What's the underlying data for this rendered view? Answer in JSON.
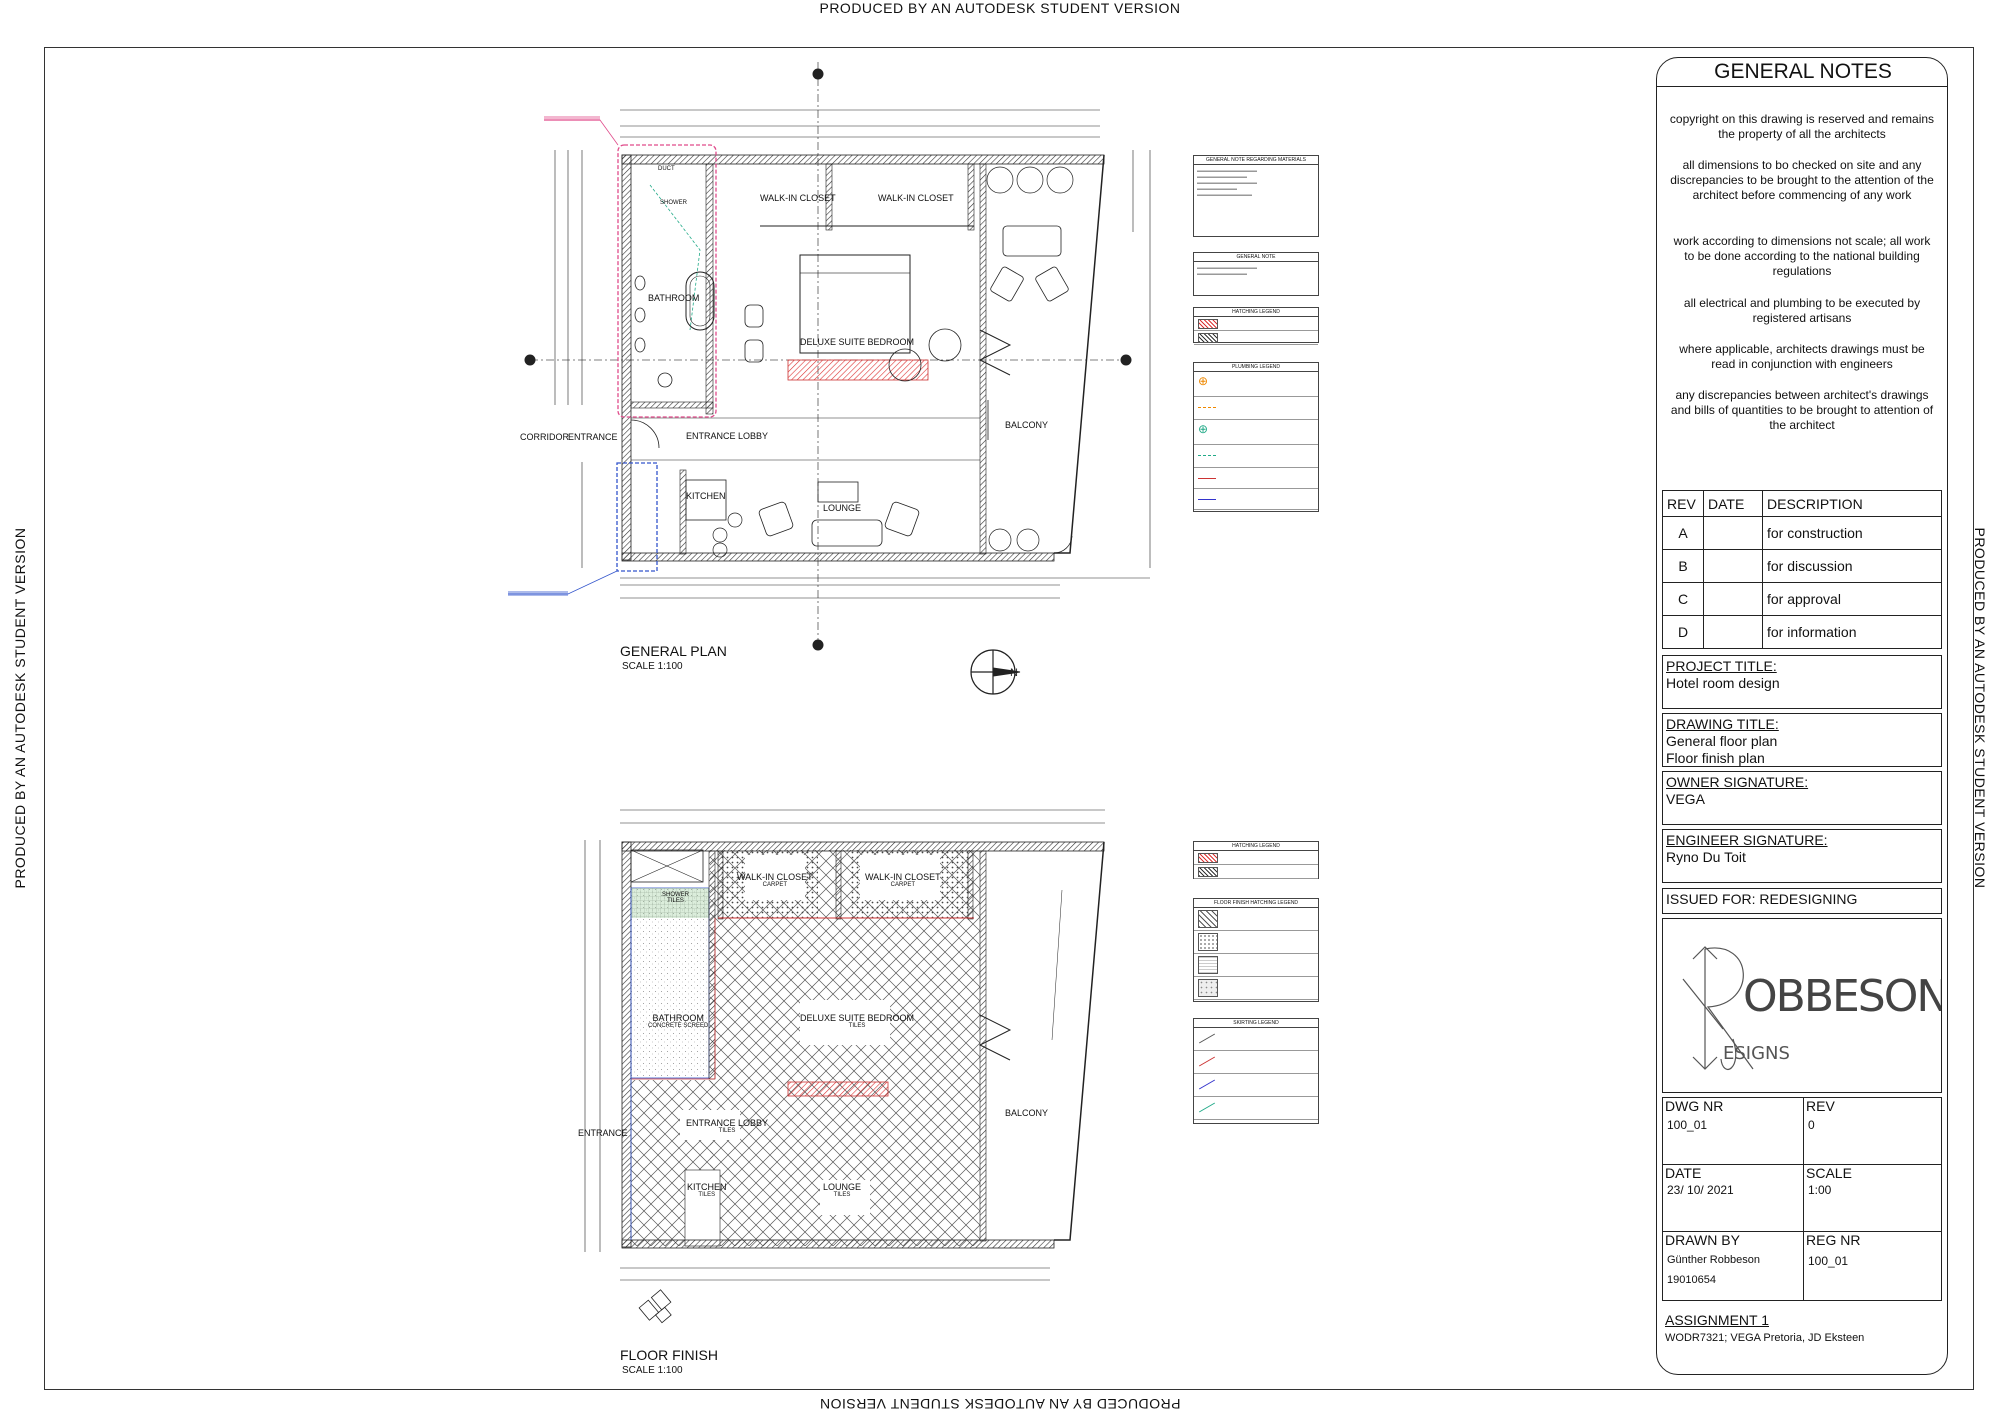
{
  "watermark": {
    "text": "PRODUCED BY AN AUTODESK STUDENT VERSION"
  },
  "plans": {
    "general": {
      "title": "GENERAL PLAN",
      "scale": "SCALE 1:100",
      "rooms": {
        "walkin1": "WALK-IN CLOSET",
        "walkin2": "WALK-IN CLOSET",
        "bathroom": "BATHROOM",
        "shower": "SHOWER",
        "duct": "DUCT",
        "bedroom": "DELUXE SUITE BEDROOM",
        "balcony": "BALCONY",
        "entrance_lobby": "ENTRANCE LOBBY",
        "kitchen": "KITCHEN",
        "lounge": "LOUNGE",
        "corridor": "CORRIDOR",
        "entrance": "ENTRANCE"
      }
    },
    "finish": {
      "title": "FLOOR FINISH",
      "scale": "SCALE 1:100",
      "rooms": {
        "walkin1": "WALK-IN CLOSET",
        "walkin1_finish": "CARPET",
        "walkin2": "WALK-IN CLOSET",
        "walkin2_finish": "CARPET",
        "shower": "SHOWER",
        "shower_finish": "TILES",
        "bathroom": "BATHROOM",
        "bathroom_finish": "CONCRETE SCREED",
        "bedroom": "DELUXE SUITE BEDROOM",
        "bedroom_finish": "TILES",
        "balcony": "BALCONY",
        "entrance_lobby": "ENTRANCE LOBBY",
        "entrance_lobby_finish": "TILES",
        "entrance": "ENTRANCE",
        "kitchen": "KITCHEN",
        "kitchen_finish": "TILES",
        "lounge": "LOUNGE",
        "lounge_finish": "TILES"
      }
    }
  },
  "legends": {
    "materials": "GENERAL NOTE REGARDING MATERIALS",
    "notes": "GENERAL NOTE",
    "hatching1": "HATCHING LEGEND",
    "plumbing": "PLUMBING LEGEND",
    "hatching2": "HATCHING LEGEND",
    "floor_finish": "FLOOR FINISH HATCHING LEGEND",
    "skirting": "SKIRTING LEGEND"
  },
  "title_block": {
    "heading": "GENERAL NOTES",
    "notes": [
      "copyright on this drawing is reserved and remains the property of all the architects",
      "all dimensions to bo checked on site and any discrepancies to be brought to the attention of the architect before commencing of any work",
      "work according to dimensions not scale; all work to  be done according to the national building regulations",
      "all electrical and plumbing to be executed by registered artisans",
      "where applicable, architects  drawings must be read in  conjunction with engineers",
      "any discrepancies between architect's drawings and bills of quantities to be brought to attention of the architect"
    ],
    "rev_table": {
      "headers": [
        "REV",
        "DATE",
        "DESCRIPTION"
      ],
      "rows": [
        [
          "A",
          "",
          "for construction"
        ],
        [
          "B",
          "",
          "for discussion"
        ],
        [
          "C",
          "",
          "for approval"
        ],
        [
          "D",
          "",
          "for information"
        ]
      ]
    },
    "project_title_label": "PROJECT TITLE:",
    "project_title": "Hotel room design",
    "drawing_title_label": "DRAWING TITLE:",
    "drawing_title_1": "General floor plan",
    "drawing_title_2": "Floor finish plan",
    "owner_label": "OWNER SIGNATURE:",
    "owner": "VEGA",
    "engineer_label": "ENGINEER SIGNATURE:",
    "engineer": "Ryno Du Toit",
    "issued_for": "ISSUED FOR: REDESIGNING",
    "logo_text": "OBBESON",
    "logo_sub": "ESIGNS",
    "dwg_nr_label": "DWG NR",
    "dwg_nr": "100_01",
    "rev_label": "REV",
    "rev": "0",
    "date_label": "DATE",
    "date": "23/ 10/ 2021",
    "scale_label": "SCALE",
    "scale": "1:00",
    "drawn_by_label": "DRAWN BY",
    "drawn_by": "Günther Robbeson",
    "student_nr": "19010654",
    "reg_nr_label": "REG NR",
    "reg_nr": "100_01",
    "assignment_label": "ASSIGNMENT 1",
    "assignment": "WODR7321; VEGA Pretoria, JD Eksteen"
  }
}
